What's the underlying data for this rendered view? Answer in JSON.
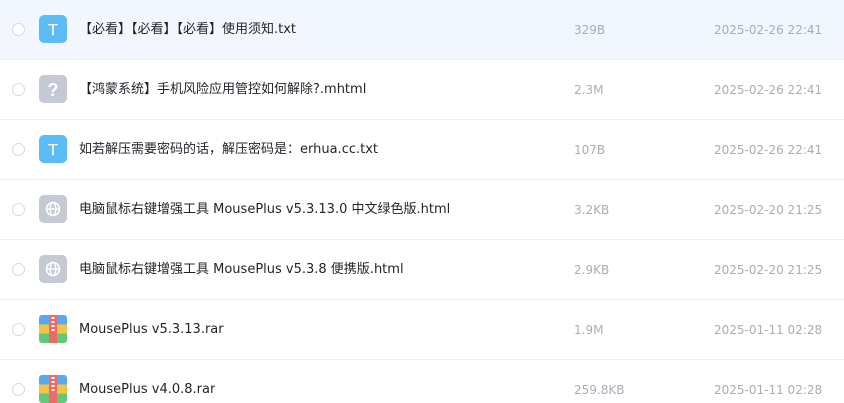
{
  "files": [
    {
      "name": "【必看】【必看】【必看】使用须知.txt",
      "size": "329B",
      "date": "2025-02-26 22:41",
      "icon": "text-file-icon",
      "icon_letter": "T"
    },
    {
      "name": "【鸿蒙系统】手机风险应用管控如何解除?.mhtml",
      "size": "2.3M",
      "date": "2025-02-26 22:41",
      "icon": "unknown-file-icon",
      "icon_letter": "?"
    },
    {
      "name": "如若解压需要密码的话，解压密码是：erhua.cc.txt",
      "size": "107B",
      "date": "2025-02-26 22:41",
      "icon": "text-file-icon",
      "icon_letter": "T"
    },
    {
      "name": "电脑鼠标右键增强工具 MousePlus v5.3.13.0 中文绿色版.html",
      "size": "3.2KB",
      "date": "2025-02-20 21:25",
      "icon": "globe-icon"
    },
    {
      "name": "电脑鼠标右键增强工具 MousePlus v5.3.8 便携版.html",
      "size": "2.9KB",
      "date": "2025-02-20 21:25",
      "icon": "globe-icon"
    },
    {
      "name": "MousePlus v5.3.13.rar",
      "size": "1.9M",
      "date": "2025-01-11 02:28",
      "icon": "archive-icon"
    },
    {
      "name": "MousePlus v4.0.8.rar",
      "size": "259.8KB",
      "date": "2025-01-11 02:28",
      "icon": "archive-icon"
    }
  ],
  "colors": {
    "text_icon": "#5cbcf5",
    "unknown_icon": "#c4c9d4",
    "globe_icon": "#c4c9d4",
    "hover_row": "#f2f6ff"
  }
}
